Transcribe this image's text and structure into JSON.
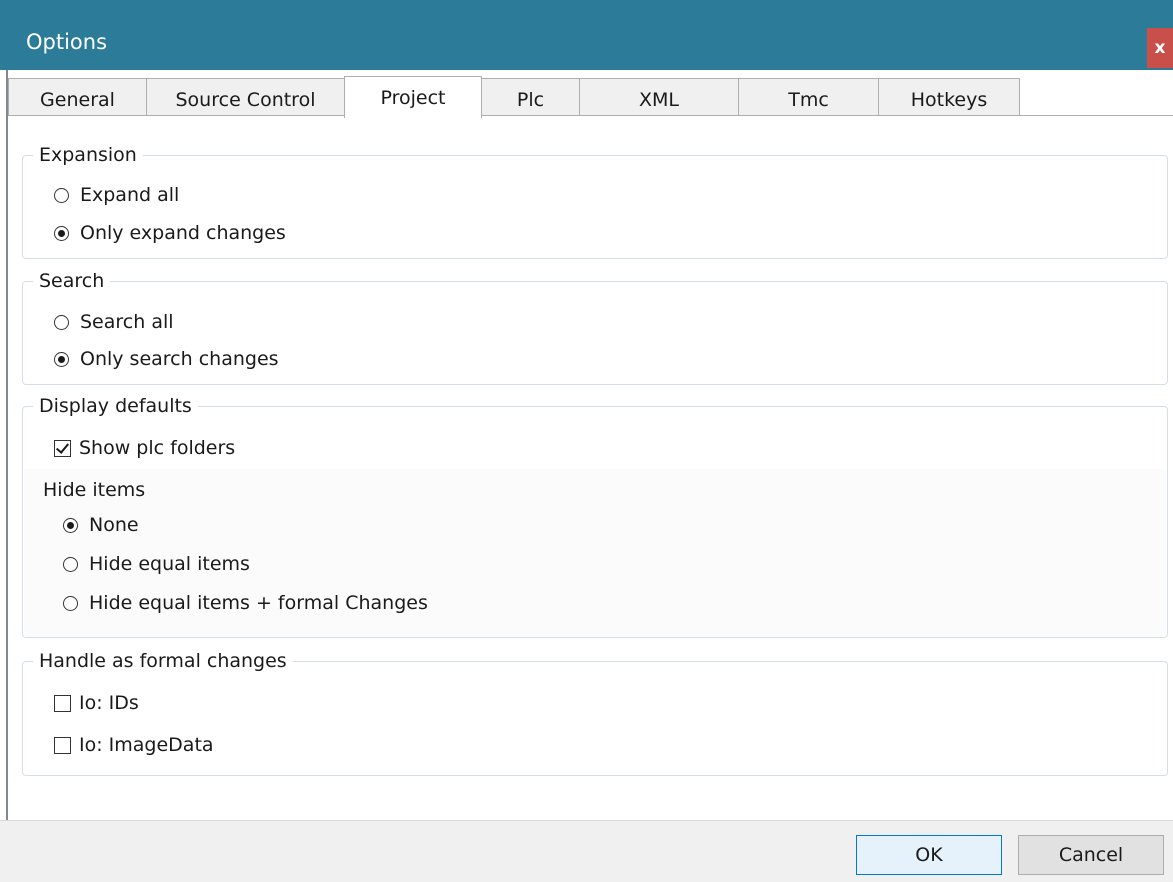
{
  "window": {
    "title": "Options",
    "close_glyph": "x"
  },
  "tabs": [
    {
      "label": "General",
      "active": false
    },
    {
      "label": "Source Control",
      "active": false
    },
    {
      "label": "Project",
      "active": true
    },
    {
      "label": "Plc",
      "active": false
    },
    {
      "label": "XML",
      "active": false
    },
    {
      "label": "Tmc",
      "active": false
    },
    {
      "label": "Hotkeys",
      "active": false
    }
  ],
  "expansion": {
    "legend": "Expansion",
    "options": [
      {
        "label": "Expand all",
        "selected": false
      },
      {
        "label": "Only expand changes",
        "selected": true
      }
    ]
  },
  "search": {
    "legend": "Search",
    "options": [
      {
        "label": "Search all",
        "selected": false
      },
      {
        "label": "Only search changes",
        "selected": true
      }
    ]
  },
  "display_defaults": {
    "legend": "Display defaults",
    "show_plc_folders": {
      "label": "Show plc folders",
      "checked": true
    },
    "hide_items_label": "Hide items",
    "hide_items_options": [
      {
        "label": "None",
        "selected": true
      },
      {
        "label": "Hide equal items",
        "selected": false
      },
      {
        "label": "Hide equal items + formal Changes",
        "selected": false
      }
    ]
  },
  "formal_changes": {
    "legend": "Handle as formal changes",
    "options": [
      {
        "label": "Io: IDs",
        "checked": false
      },
      {
        "label": "Io: ImageData",
        "checked": false
      }
    ]
  },
  "buttons": {
    "ok": "OK",
    "cancel": "Cancel"
  },
  "colors": {
    "titlebar": "#2b7b99",
    "close": "#c9504a",
    "default_button_border": "#0078d7"
  }
}
